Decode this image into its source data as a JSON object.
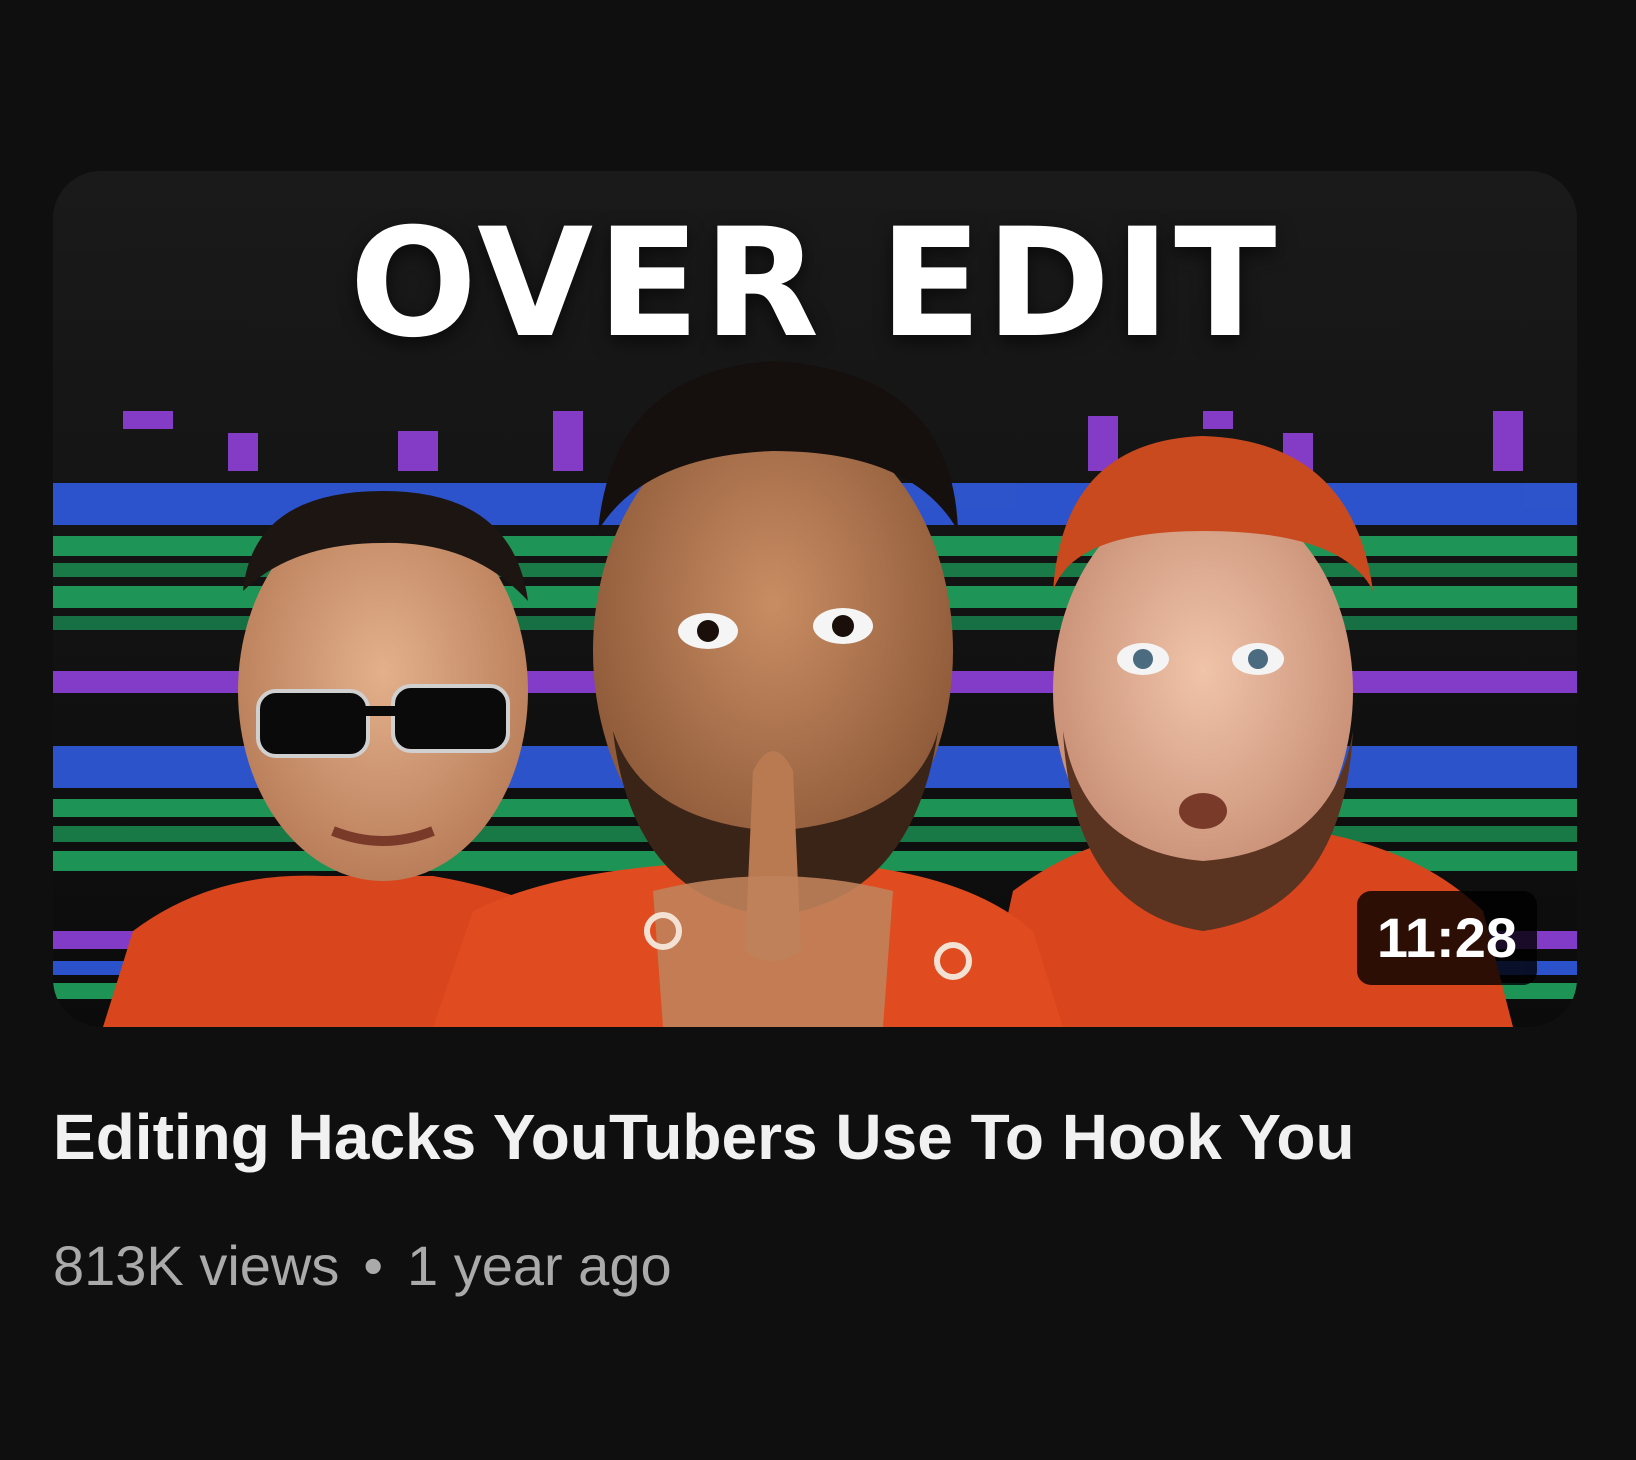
{
  "video": {
    "thumbnail_text": "OVER EDIT",
    "duration": "11:28",
    "title": "Editing Hacks YouTubers Use To Hook You",
    "views": "813K views",
    "separator": "•",
    "age": "1 year ago"
  },
  "colors": {
    "background": "#0f0f0f",
    "title_text": "#f1f1f1",
    "meta_text": "#aaaaaa",
    "hoodie_orange": "#d9451c",
    "timeline_blue": "#2f57d6",
    "timeline_green": "#1f9b5a",
    "timeline_purple": "#8a3fd1"
  }
}
